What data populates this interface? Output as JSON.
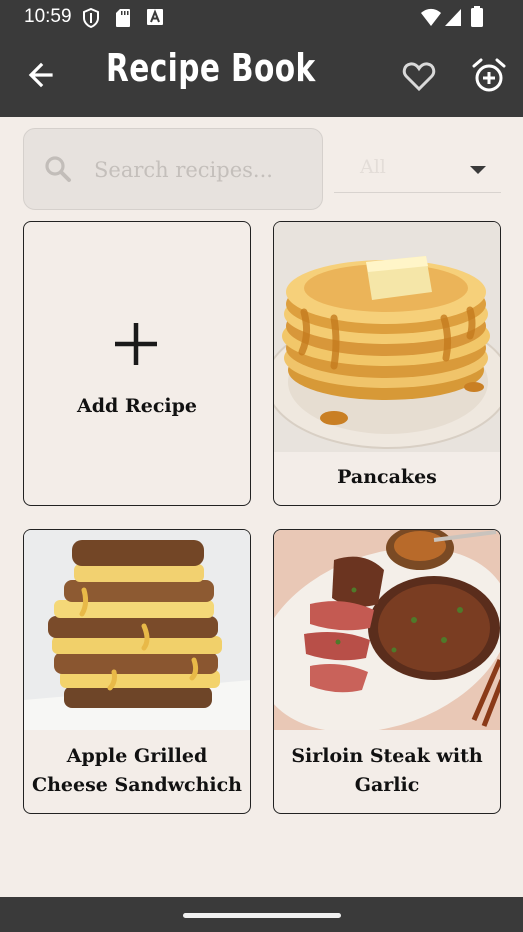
{
  "status_bar": {
    "time": "10:59",
    "icons": [
      "shield-icon",
      "sd-card-icon",
      "font-a-icon",
      "wifi-icon",
      "signal-icon",
      "battery-icon"
    ]
  },
  "app_bar": {
    "title": "Recipe Book",
    "back_icon": "arrow-back-icon",
    "favorite_icon": "heart-outline-icon",
    "alarm_icon": "alarm-add-icon"
  },
  "search": {
    "placeholder": "Search recipes...",
    "value": ""
  },
  "filter": {
    "selected": "All"
  },
  "recipes": {
    "add_label": "Add Recipe",
    "items": [
      {
        "title": "Pancakes"
      },
      {
        "title": "Apple Grilled Cheese Sandwchich"
      },
      {
        "title": "Sirloin Steak with Garlic"
      }
    ]
  },
  "colors": {
    "app_bar": "#3a3a3a",
    "background": "#f3ede8",
    "search_fill": "#e7e2de"
  }
}
